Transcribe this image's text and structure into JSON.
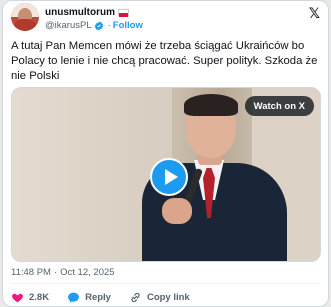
{
  "post": {
    "author": {
      "display_name": "unusmultorum",
      "handle": "@ikarusPL",
      "follow_label": "Follow",
      "separator": "·"
    },
    "text": "A tutaj Pan Memcen mówi że trzeba ściągać Ukraińców bo Polacy to lenie i nie chcą pracować. Super polityk. Szkoda że nie Polski",
    "media": {
      "watch_label": "Watch on X"
    },
    "time": "11:48 PM",
    "date": "Oct 12, 2025",
    "time_separator": "·",
    "actions": {
      "likes": "2.8K",
      "reply_label": "Reply",
      "copy_link_label": "Copy link"
    }
  },
  "colors": {
    "accent": "#1d9bf0",
    "like": "#f91880",
    "secondary_text": "#536471"
  },
  "icons": [
    "x-logo-icon",
    "verified-badge-icon",
    "poland-flag-icon",
    "play-icon",
    "heart-icon",
    "reply-icon",
    "link-icon"
  ]
}
